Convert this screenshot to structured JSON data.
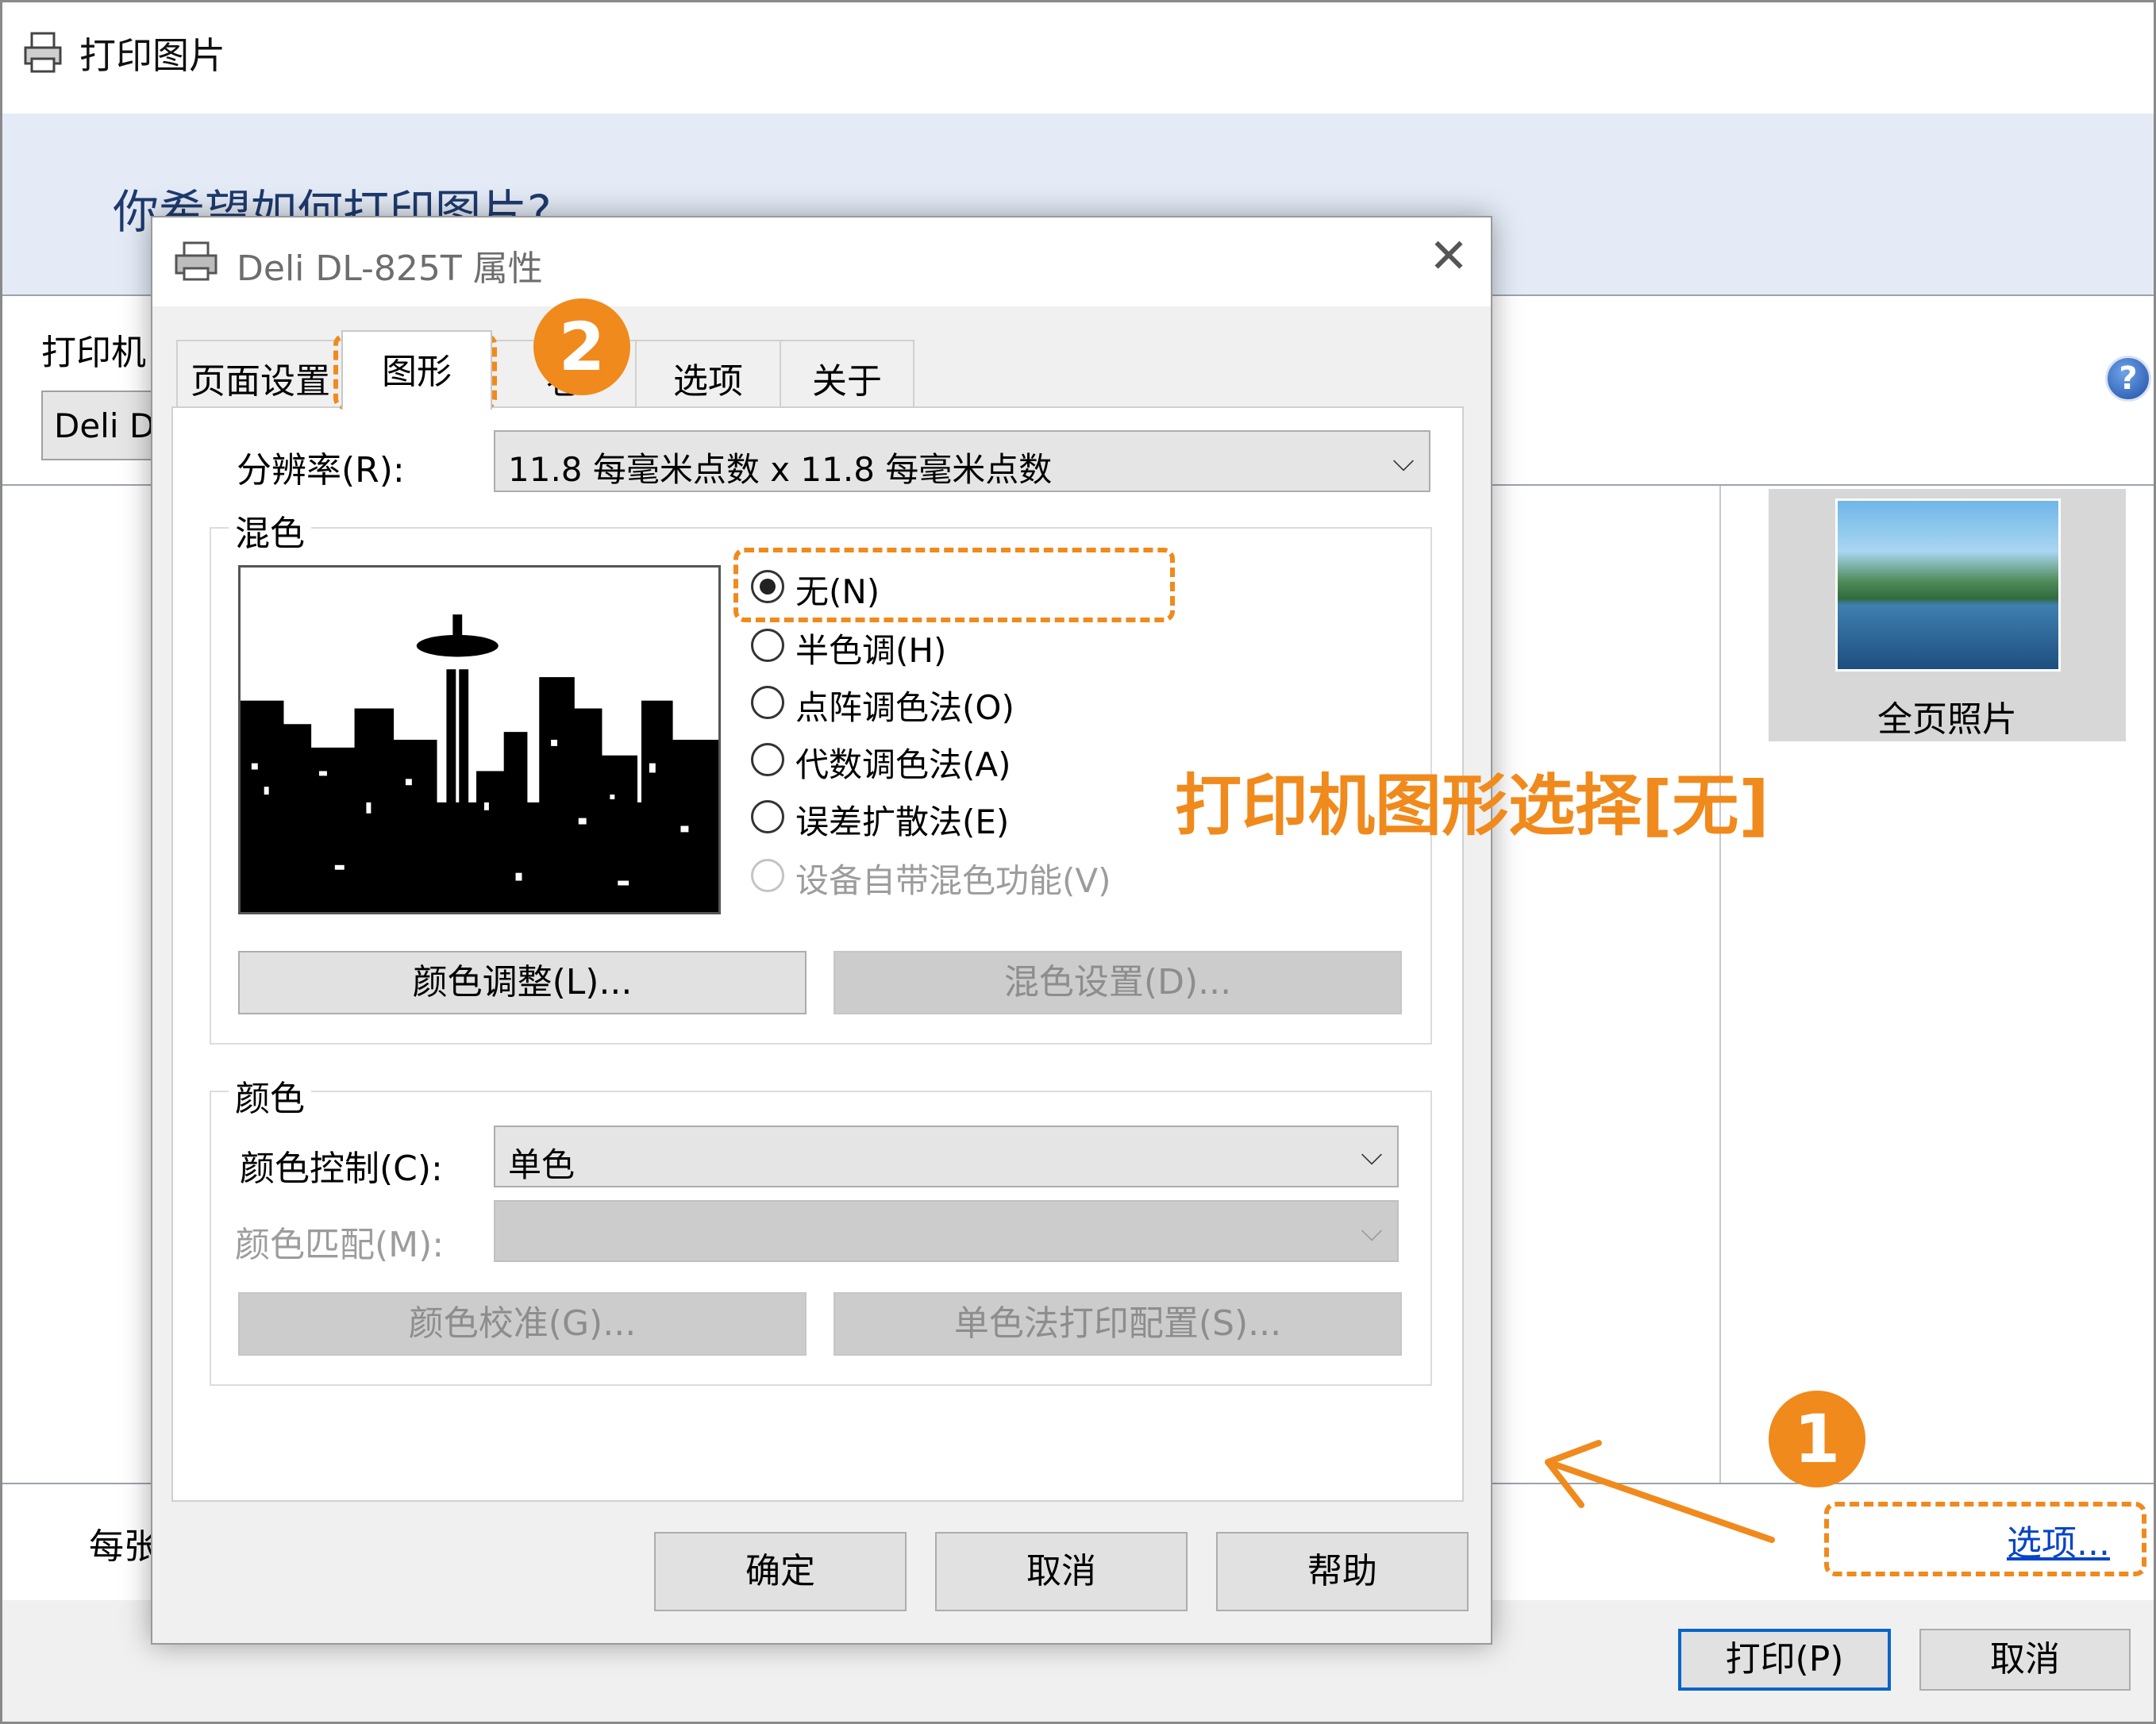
{
  "window": {
    "title": "打印图片",
    "heading": "你希望如何打印图片?",
    "printer_label": "打印机",
    "printer_value": "Deli D",
    "thumbnail_caption": "全页照片",
    "per_page_label": "每张",
    "options_link": "选项...",
    "print_button": "打印(P)",
    "cancel_button": "取消",
    "help_glyph": "?"
  },
  "dialog": {
    "title": "Deli DL-825T 属性",
    "close_glyph": "✕",
    "tabs": [
      {
        "label": "页面设置"
      },
      {
        "label": "图形",
        "active": true
      },
      {
        "label": "卷"
      },
      {
        "label": "选项"
      },
      {
        "label": "关于"
      }
    ],
    "resolution": {
      "label": "分辨率(R):",
      "value": "11.8 每毫米点数 x 11.8 每毫米点数"
    },
    "dither": {
      "group_title": "混色",
      "options": [
        {
          "label": "无(N)",
          "checked": true,
          "disabled": false
        },
        {
          "label": "半色调(H)",
          "checked": false,
          "disabled": false
        },
        {
          "label": "点阵调色法(O)",
          "checked": false,
          "disabled": false
        },
        {
          "label": "代数调色法(A)",
          "checked": false,
          "disabled": false
        },
        {
          "label": "误差扩散法(E)",
          "checked": false,
          "disabled": false
        },
        {
          "label": "设备自带混色功能(V)",
          "checked": false,
          "disabled": true
        }
      ],
      "color_adjust_button": "颜色调整(L)...",
      "dither_settings_button": "混色设置(D)..."
    },
    "color": {
      "group_title": "颜色",
      "control_label": "颜色控制(C):",
      "control_value": "单色",
      "match_label": "颜色匹配(M):",
      "match_value": "",
      "calibrate_button": "颜色校准(G)...",
      "mono_config_button": "单色法打印配置(S)..."
    },
    "ok_button": "确定",
    "cancel_button": "取消",
    "help_button": "帮助",
    "chevron_glyph": "⌵"
  },
  "annotations": {
    "step1": "1",
    "step2": "2",
    "caption": "打印机图形选择[无]",
    "accent_color": "#f08a1c"
  }
}
